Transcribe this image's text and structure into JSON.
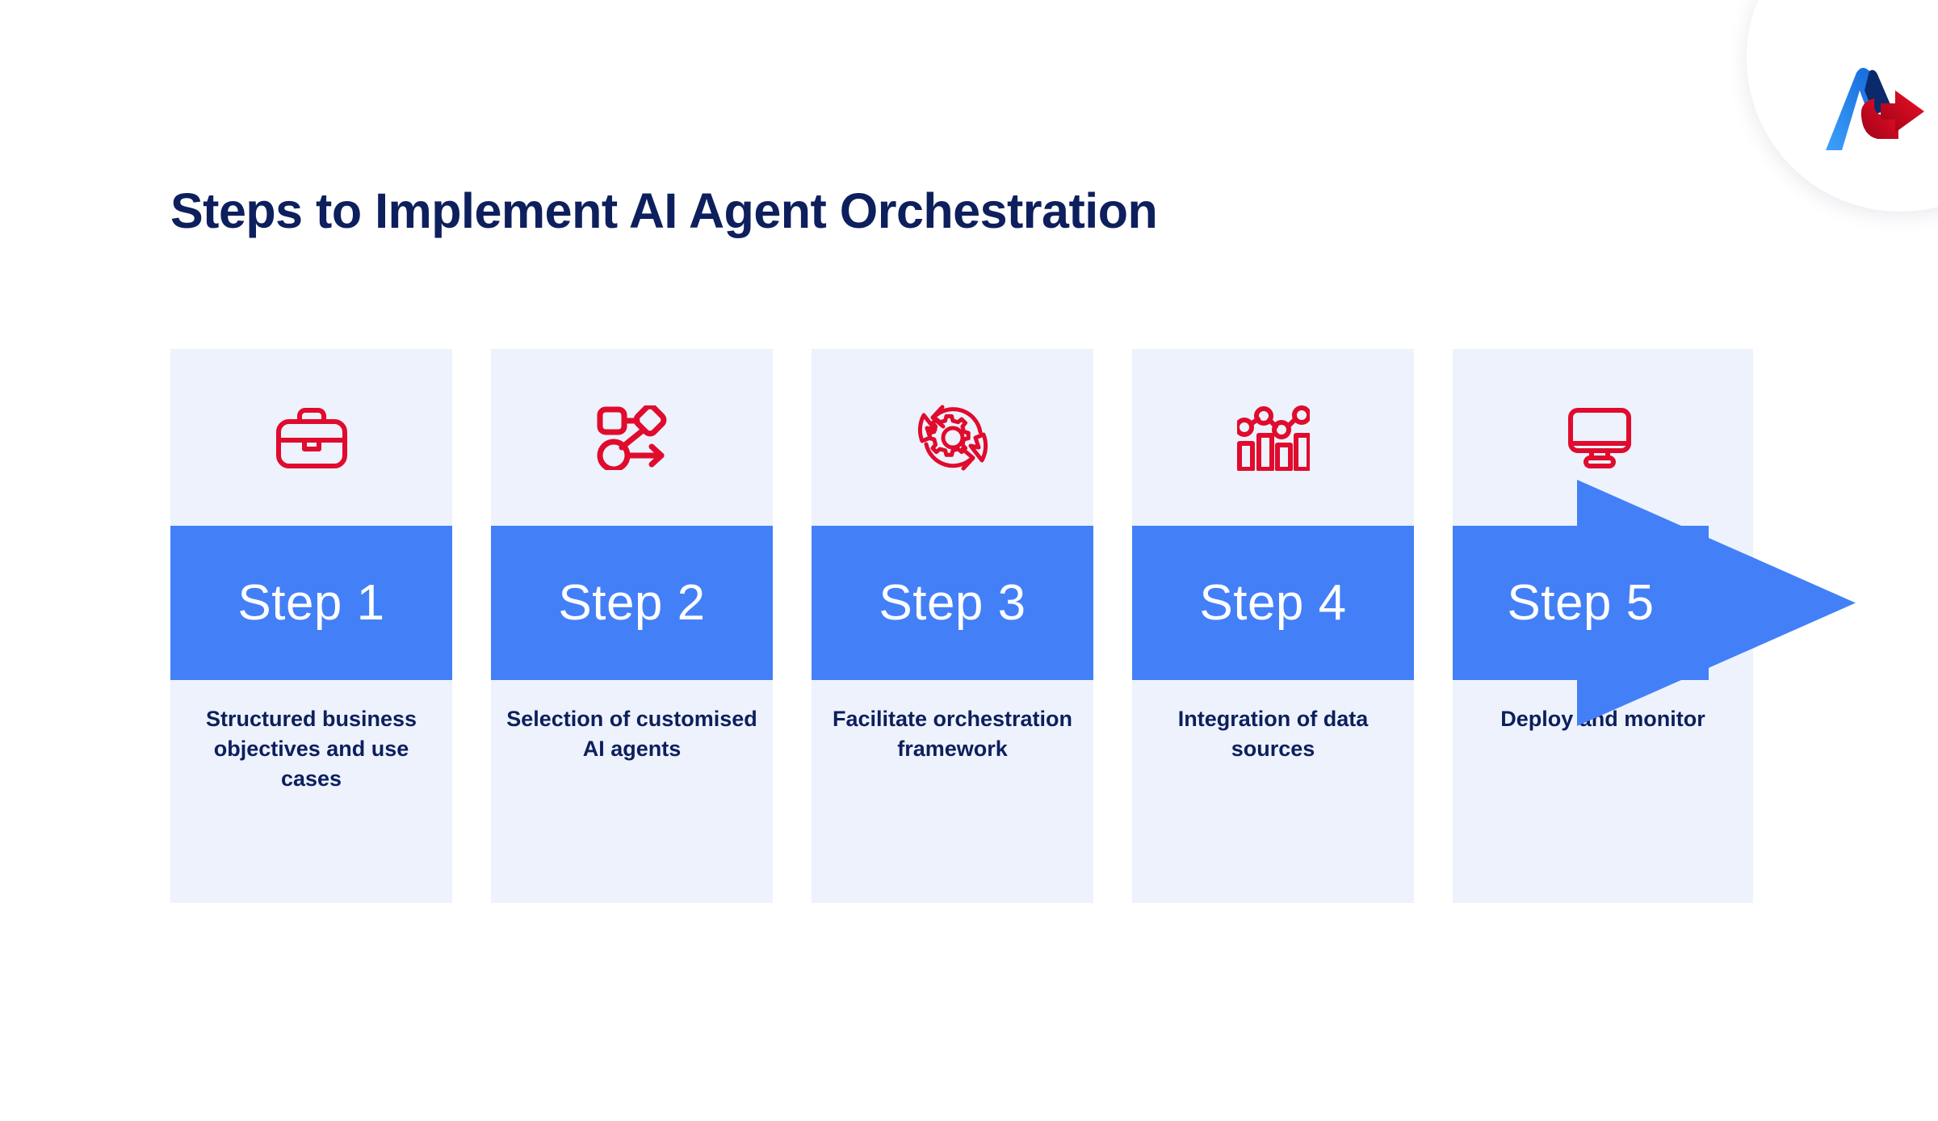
{
  "page": {
    "title": "Steps to Implement AI Agent Orchestration",
    "background_color": "#ffffff"
  },
  "logo": {
    "name": "brand-logo",
    "shape": "stylized-A-with-arrow",
    "blue_color": "#2f7ef0",
    "dark_blue_color": "#0b2a6b",
    "red_color": "#d0021b",
    "badge_color": "#ffffff"
  },
  "theme": {
    "card_background": "#edf2fd",
    "band_color": "#4380f7",
    "band_text_color": "#ffffff",
    "icon_color": "#e00b2d",
    "title_color": "#0d1f5c",
    "caption_color": "#0d1f5c"
  },
  "steps": [
    {
      "band_label": "Step 1",
      "caption": "Structured business objectives and use cases",
      "icon": "briefcase-icon",
      "has_arrowhead": false
    },
    {
      "band_label": "Step 2",
      "caption": "Selection of customised AI agents",
      "icon": "workflow-icon",
      "has_arrowhead": false
    },
    {
      "band_label": "Step 3",
      "caption": "Facilitate orchestration framework",
      "icon": "gear-cycle-icon",
      "has_arrowhead": false
    },
    {
      "band_label": "Step 4",
      "caption": "Integration of data sources",
      "icon": "bar-chart-icon",
      "has_arrowhead": false
    },
    {
      "band_label": "Step 5",
      "caption": "Deploy and monitor",
      "icon": "monitor-icon",
      "has_arrowhead": true
    }
  ]
}
